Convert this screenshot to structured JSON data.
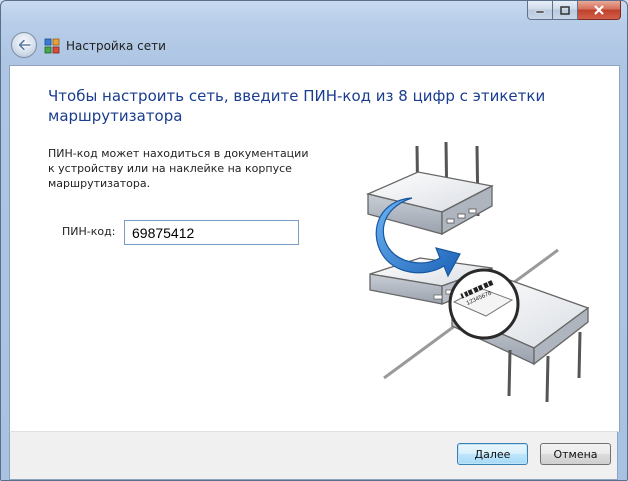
{
  "window": {
    "title": "Настройка сети"
  },
  "caption_buttons": [
    "minimize",
    "maximize",
    "close"
  ],
  "main": {
    "instruction": "Чтобы настроить сеть, введите ПИН-код из 8 цифр с этикетки маршрутизатора",
    "description": "ПИН-код может находиться в документации к устройству или на наклейке на корпусе маршрутизатора.",
    "pin_label": "ПИН-код:",
    "pin_value": "69875412",
    "sticker_text": "12345678"
  },
  "footer": {
    "next_label_underlined": "Д",
    "next_label_rest": "алее",
    "cancel_label": "Отмена"
  },
  "colors": {
    "instruction": "#1a3d8f",
    "arrow": "#2d7fd6",
    "accent": "#3c7fb1"
  },
  "icons": {
    "back": "back-arrow-icon",
    "network": "network-wizard-icon"
  }
}
